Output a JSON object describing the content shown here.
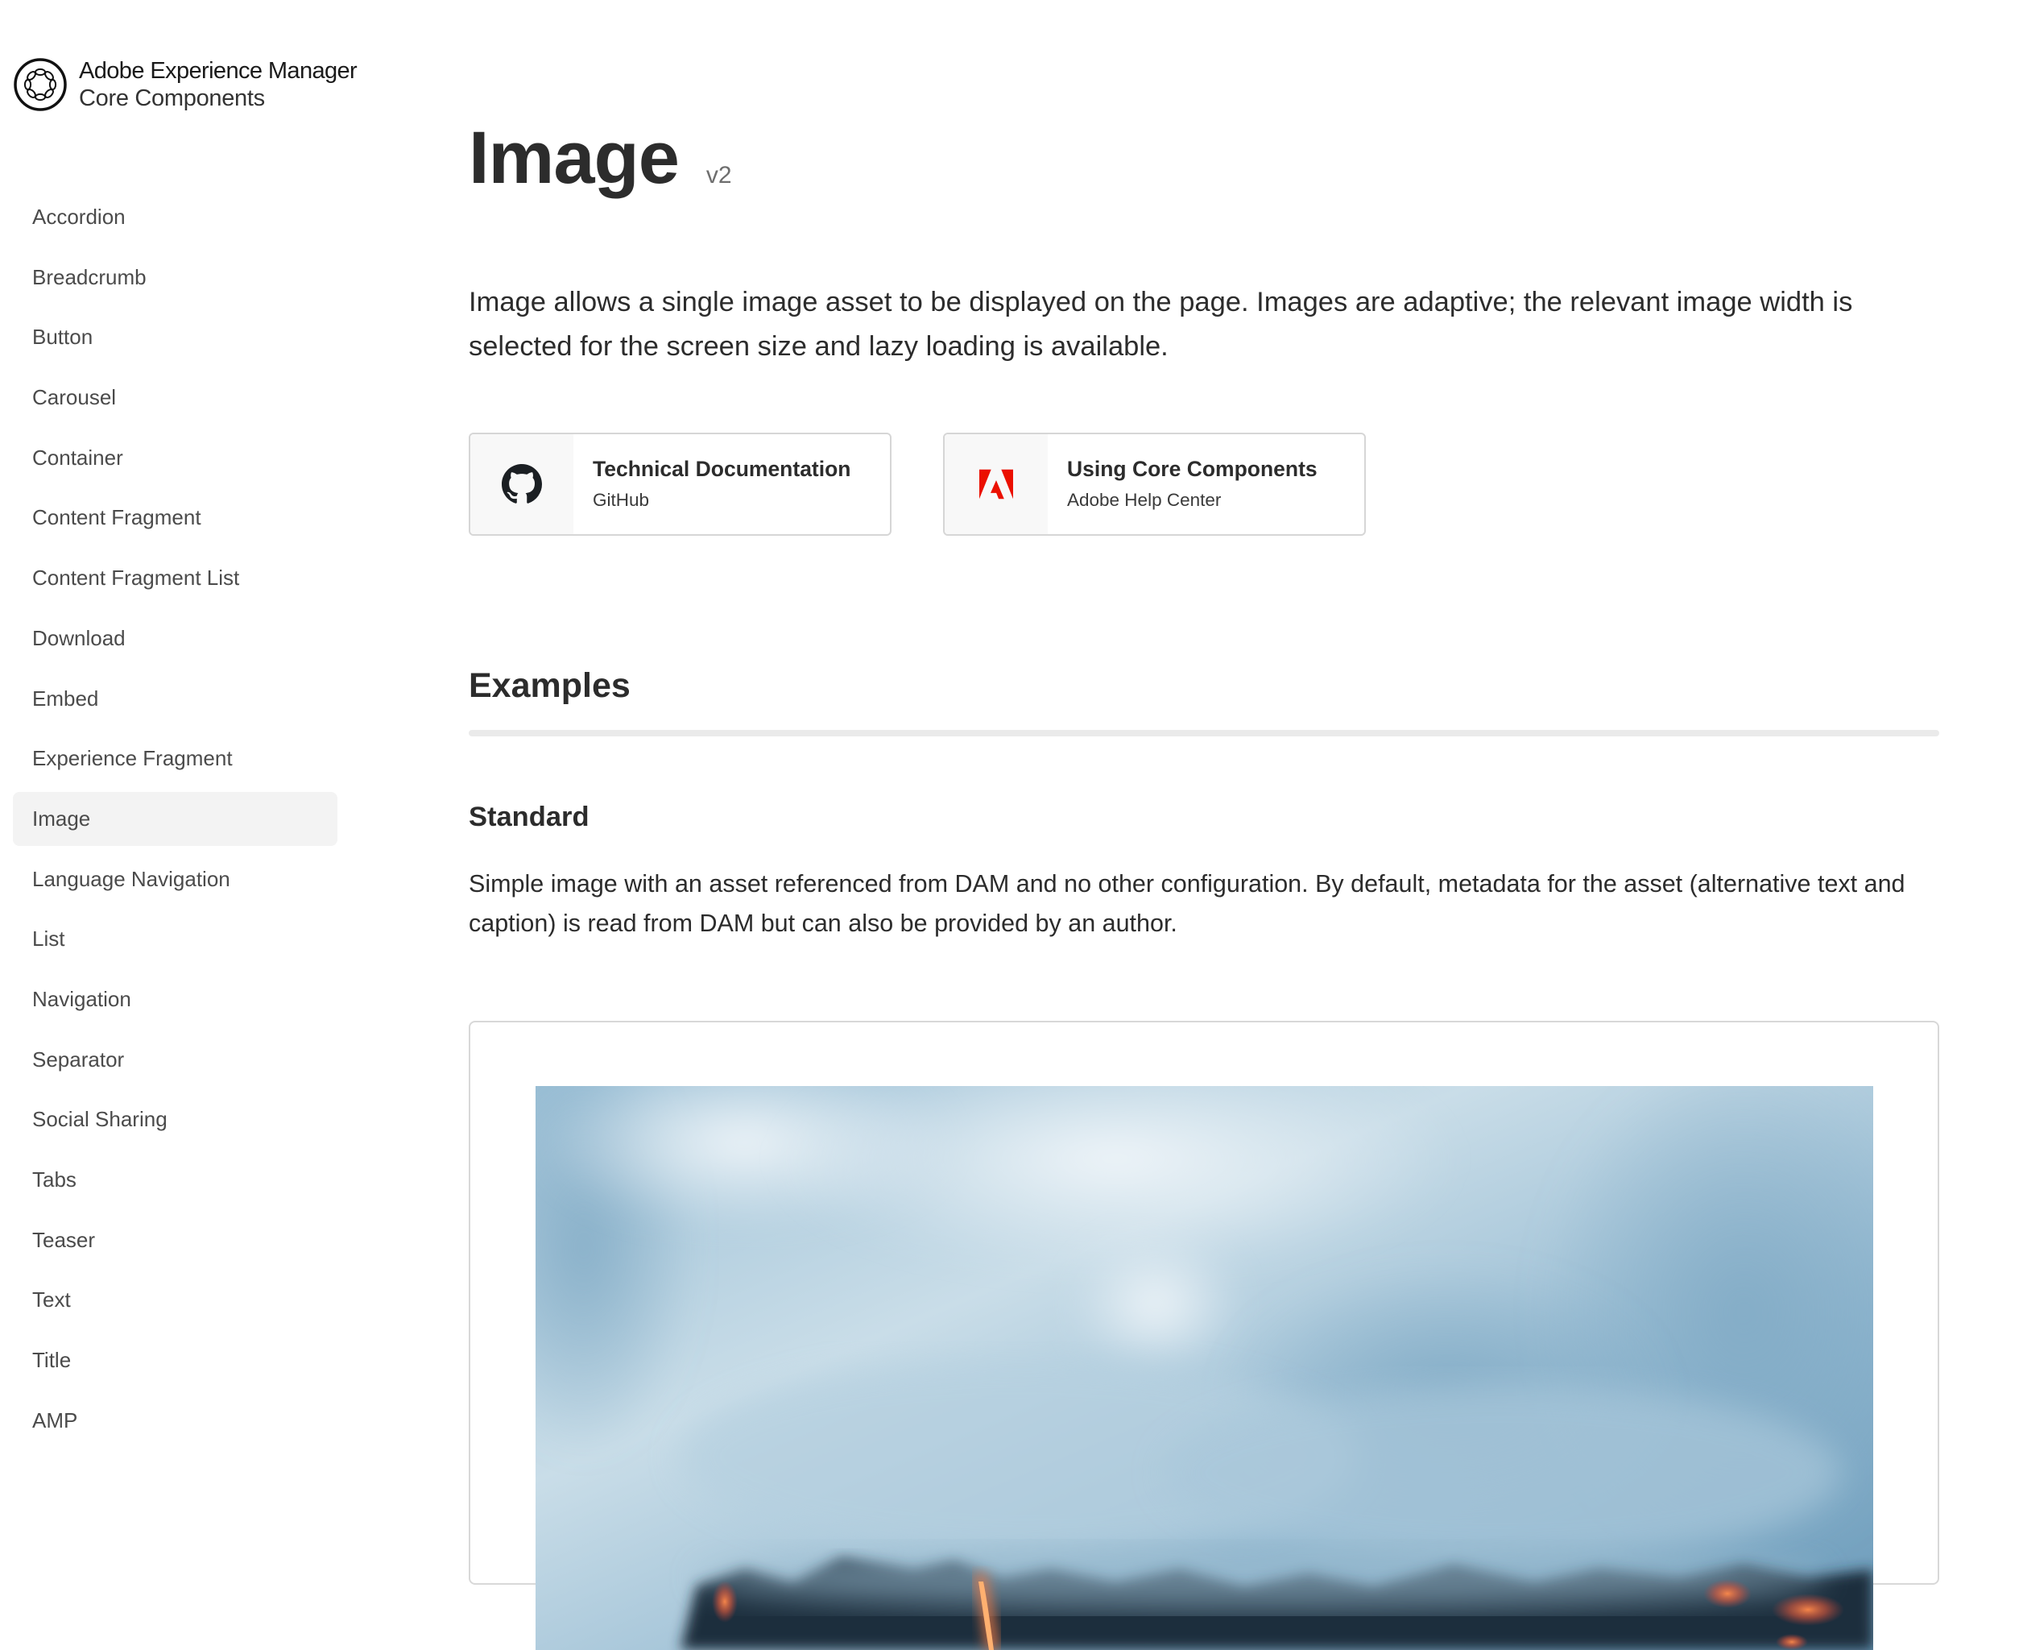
{
  "brand": {
    "line1": "Adobe Experience Manager",
    "line2": "Core Components",
    "icon": "aem-logo-icon"
  },
  "sidebar": {
    "active": "Image",
    "items": [
      {
        "label": "Accordion"
      },
      {
        "label": "Breadcrumb"
      },
      {
        "label": "Button"
      },
      {
        "label": "Carousel"
      },
      {
        "label": "Container"
      },
      {
        "label": "Content Fragment"
      },
      {
        "label": "Content Fragment List"
      },
      {
        "label": "Download"
      },
      {
        "label": "Embed"
      },
      {
        "label": "Experience Fragment"
      },
      {
        "label": "Image"
      },
      {
        "label": "Language Navigation"
      },
      {
        "label": "List"
      },
      {
        "label": "Navigation"
      },
      {
        "label": "Separator"
      },
      {
        "label": "Social Sharing"
      },
      {
        "label": "Tabs"
      },
      {
        "label": "Teaser"
      },
      {
        "label": "Text"
      },
      {
        "label": "Title"
      },
      {
        "label": "AMP"
      }
    ]
  },
  "page": {
    "title": "Image",
    "version": "v2",
    "description": "Image allows a single image asset to be displayed on the page. Images are adaptive; the relevant image width is selected for the screen size and lazy loading is available."
  },
  "cards": [
    {
      "title": "Technical Documentation",
      "subtitle": "GitHub",
      "icon": "github-icon"
    },
    {
      "title": "Using Core Components",
      "subtitle": "Adobe Help Center",
      "icon": "adobe-icon"
    }
  ],
  "examples": {
    "heading": "Examples",
    "standard": {
      "heading": "Standard",
      "text": "Simple image with an asset referenced from DAM and no other configuration. By default, metadata for the asset (alternative text and caption) is read from DAM but can also be provided by an author.",
      "image_subject": "lava flow with steam clouds"
    }
  },
  "colors": {
    "text": "#2c2c2c",
    "nav_text": "#4b4b4b",
    "active_bg": "#f3f3f3",
    "border": "#d6d6d6",
    "separator": "#eaeaea",
    "adobe_red": "#eb1000"
  }
}
